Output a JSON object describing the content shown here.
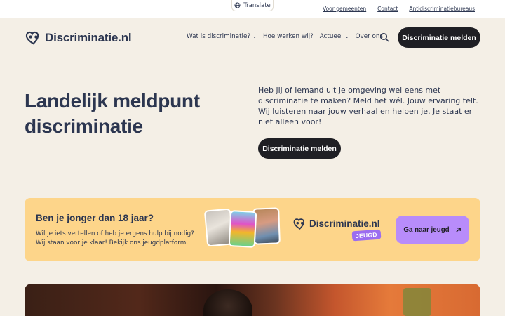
{
  "topbar": {
    "translate_label": "Translate",
    "links": [
      "Voor gemeenten",
      "Contact",
      "Antidiscriminatiebureaus"
    ]
  },
  "header": {
    "logo_text": "Discriminatie.nl",
    "nav": [
      {
        "label": "Wat is discriminatie?",
        "has_dropdown": true
      },
      {
        "label": "Hoe werken wij?",
        "has_dropdown": false
      },
      {
        "label": "Actueel",
        "has_dropdown": true
      },
      {
        "label": "Over ons",
        "has_dropdown": false
      }
    ],
    "search_icon": "search-icon",
    "cta_label": "Discriminatie melden"
  },
  "hero": {
    "title": "Landelijk meldpunt discriminatie",
    "text": "Heb jij of iemand uit je omgeving wel eens met discriminatie te maken? Meld het wél. Jouw ervaring telt. Wij luisteren naar jouw verhaal en helpen je. Je staat er niet alleen voor!",
    "cta_label": "Discriminatie melden"
  },
  "youth_banner": {
    "title": "Ben je jonger dan 18 jaar?",
    "text": "Wil je iets vertellen of heb je ergens hulp bij nodig? Wij staan voor je klaar! Bekijk ons jeugdplatform.",
    "logo_text": "Discriminatie.nl",
    "badge": "JEUGD",
    "cta_label": "Ga naar jeugd"
  },
  "colors": {
    "background": "#f4efe6",
    "text": "#2c3650",
    "button_dark": "#1f1f24",
    "banner": "#fdd58a",
    "accent_purple": "#b88cfb"
  }
}
